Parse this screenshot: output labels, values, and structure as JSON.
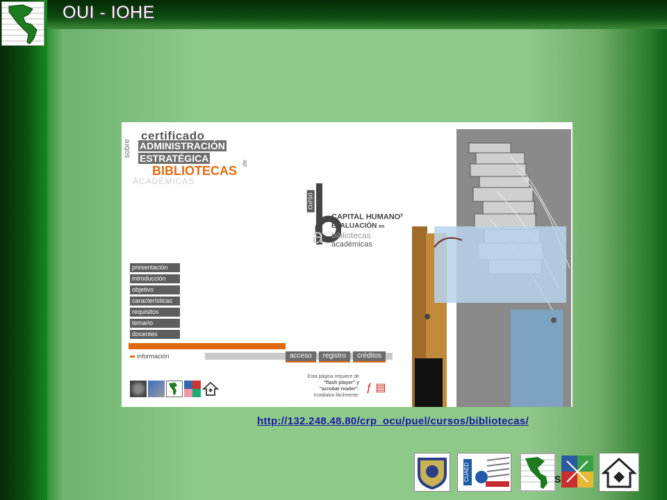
{
  "header": {
    "title": "OUI - IOHE"
  },
  "screenshot": {
    "certificate": {
      "line1": "certificado",
      "sobre": "sobre",
      "line2": "ADMINISTRACIÓN",
      "line3": "ESTRATÉGICA",
      "de": "de",
      "line4": "BIBLIOTECAS",
      "line5": "ACADÉMICAS"
    },
    "course": {
      "curso": "curso",
      "line1": "CAPITAL HUMANO",
      "y": "y",
      "line2": "EVALUACIÓN",
      "en": "en",
      "line3": "bibliotecas",
      "line4": "académicas"
    },
    "menu": [
      "presentación",
      "introducción",
      "objetivo",
      "características",
      "requisitos",
      "temario",
      "docentes"
    ],
    "info_label": "información",
    "buttons": [
      "acceso",
      "registro",
      "créditos"
    ],
    "requirements": [
      "Esta página requiere de",
      "\"flash player\" y",
      "\"acrobat reader\".",
      "Instálalos fácilmente:"
    ]
  },
  "link": {
    "url": "http://132.248.48.80/crp_ocu/puel/cursos/bibliotecas/"
  },
  "footer": {
    "partial_text": "S"
  },
  "colors": {
    "accent_orange": "#e06a10",
    "link_blue": "#1a1aa0",
    "bg_green": "#8fca8a"
  }
}
